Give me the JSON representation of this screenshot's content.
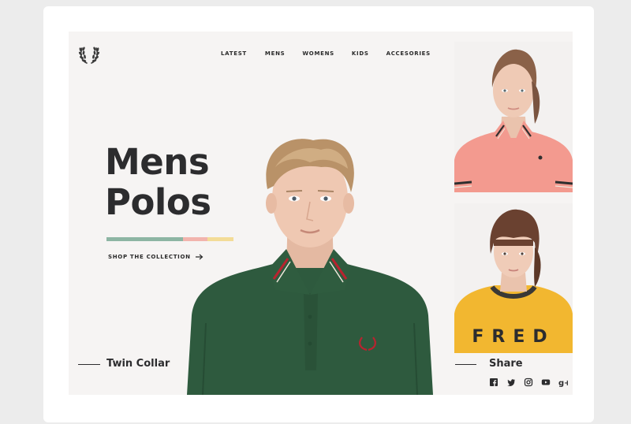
{
  "nav": {
    "items": [
      {
        "label": "LATEST"
      },
      {
        "label": "MENS"
      },
      {
        "label": "WOMENS"
      },
      {
        "label": "KIDS"
      },
      {
        "label": "ACCESORIES"
      }
    ]
  },
  "hero": {
    "title_line1": "Mens",
    "title_line2": "Polos",
    "cta_label": "SHOP THE COLLECTION",
    "stripe_colors": [
      "#8db5a3",
      "#f2b4ad",
      "#f3dc97"
    ]
  },
  "product": {
    "caption": "Twin Collar"
  },
  "share": {
    "label": "Share",
    "icons": [
      "facebook-icon",
      "twitter-icon",
      "instagram-icon",
      "youtube-icon",
      "google-plus-icon"
    ]
  },
  "side_photos": {
    "bottom_shirt_text": "FRED"
  },
  "colors": {
    "background": "#f6f4f3",
    "text": "#2c2c2e",
    "polo_green": "#2e5a3e",
    "polo_pink": "#f39a8f",
    "shirt_yellow": "#f2b730",
    "tipping_red": "#b9232f"
  }
}
